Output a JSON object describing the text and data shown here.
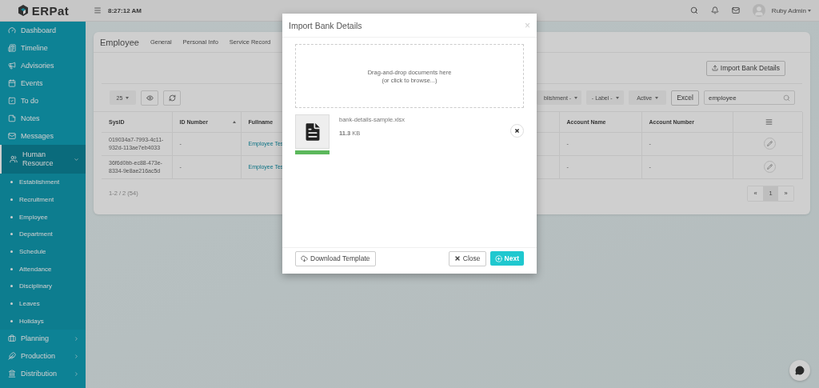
{
  "header": {
    "time": "8:27:12 AM",
    "user": "Ruby Admin"
  },
  "sidebar": {
    "logo": "ERPat",
    "items": [
      {
        "label": "Dashboard"
      },
      {
        "label": "Timeline"
      },
      {
        "label": "Advisories"
      },
      {
        "label": "Events"
      },
      {
        "label": "To do"
      },
      {
        "label": "Notes"
      },
      {
        "label": "Messages"
      },
      {
        "label": "Human Resource",
        "expanded": true,
        "children": [
          {
            "label": "Establishment"
          },
          {
            "label": "Recruitment"
          },
          {
            "label": "Employee"
          },
          {
            "label": "Department"
          },
          {
            "label": "Schedule"
          },
          {
            "label": "Attendance"
          },
          {
            "label": "Disciplinary"
          },
          {
            "label": "Leaves"
          },
          {
            "label": "Holidays"
          }
        ]
      },
      {
        "label": "Planning",
        "expanded": false
      },
      {
        "label": "Production",
        "expanded": false
      },
      {
        "label": "Distribution",
        "expanded": false
      }
    ]
  },
  "page": {
    "title": "Employee",
    "tabs": [
      "General",
      "Personal Info",
      "Service Record"
    ],
    "import_button": "Import Bank Details",
    "page_size": "25",
    "filters": [
      "blishment -",
      "- Label -",
      "Active"
    ],
    "excel_button": "Excel",
    "search": {
      "value": "employee"
    },
    "table": {
      "columns": [
        {
          "kind": "text",
          "label": "SysID",
          "sorted": false
        },
        {
          "kind": "text",
          "label": "ID Number",
          "sorted": true
        },
        {
          "kind": "text",
          "label": "Fullname",
          "sorted": false
        },
        {
          "kind": "hidden"
        },
        {
          "kind": "text",
          "label": "Account Name",
          "sorted": false
        },
        {
          "kind": "text",
          "label": "Account Number",
          "sorted": false
        },
        {
          "kind": "menu"
        }
      ],
      "rows": [
        {
          "sysid": "019034a7-7993-4c11-932d-113ae7eb4033",
          "id_number": "-",
          "fullname": "Employee Tes",
          "account_name": "-",
          "account_number": "-"
        },
        {
          "sysid": "36f6d0bb-ec88-473e-8334-9e8ae216ac5d",
          "id_number": "-",
          "fullname": "Employee Tes",
          "account_name": "-",
          "account_number": "-"
        }
      ]
    },
    "summary": "1-2 / 2 (54)",
    "pagination": {
      "prev": "«",
      "next": "»",
      "pages": [
        {
          "label": "1",
          "selected": true
        }
      ]
    }
  },
  "modal": {
    "title": "Import Bank Details",
    "close": "×",
    "dropzone": [
      "Drag-and-drop documents here",
      "(or click to browse...)"
    ],
    "file": {
      "name": "bank-details-sample.xlsx",
      "size": "**11.3** KB",
      "level": 1
    },
    "buttons": {
      "download": "Download Template",
      "close": "Close",
      "next": "Next"
    }
  }
}
